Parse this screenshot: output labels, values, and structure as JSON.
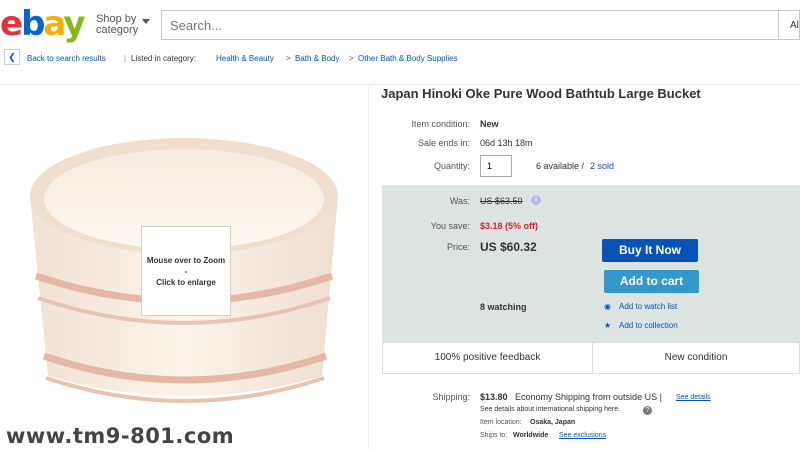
{
  "header": {
    "logo": "ebay",
    "shop_by": "Shop by",
    "category": "category",
    "search_placeholder": "Search...",
    "search_category_label": "Al"
  },
  "breadcrumb": {
    "back": "Back to search results",
    "separator": "|",
    "listed_in": "Listed in category:",
    "items": [
      "Health & Beauty",
      "Bath & Body",
      "Other Bath & Body Supplies"
    ]
  },
  "image": {
    "zoom_line1": "Mouse over to Zoom",
    "zoom_dash": "-",
    "zoom_line2": "Click to enlarge",
    "watermark": "www.tm9-801.com"
  },
  "item": {
    "title": "Japan Hinoki Oke Pure Wood Bathtub Large Bucket",
    "condition_label": "Item condition:",
    "condition": "New",
    "sale_ends_label": "Sale ends in:",
    "sale_ends": "06d 13h 18m",
    "quantity_label": "Quantity:",
    "quantity": "1",
    "available": "6 available /",
    "sold": "2 sold"
  },
  "pricing": {
    "was_label": "Was:",
    "was": "US $63.50",
    "save_label": "You save:",
    "save": "$3.18 (5% off)",
    "price_label": "Price:",
    "price": "US $60.32",
    "watching": "8 watching",
    "buy_now": "Buy It Now",
    "add_to_cart": "Add to cart",
    "watch_list": "Add to watch list",
    "collection": "Add to collection"
  },
  "feedback": {
    "positive": "100% positive feedback",
    "condition": "New condition"
  },
  "shipping": {
    "label": "Shipping:",
    "cost": "$13.80",
    "method": "Economy Shipping from outside US |",
    "see_details": "See details",
    "intl_note": "See details about international shipping here.",
    "location_label": "Item location:",
    "location": "Osaka, Japan",
    "ships_to_label": "Ships to:",
    "ships_to": "Worldwide",
    "exclusions": "See exclusions"
  },
  "colors": {
    "ebay_red": "#e53238",
    "ebay_blue": "#0064d2",
    "ebay_yellow": "#f5af02",
    "ebay_green": "#86b817",
    "buy_now_bg": "#0654ba",
    "cart_bg": "#3498ca",
    "save_red": "#dd1e31"
  }
}
